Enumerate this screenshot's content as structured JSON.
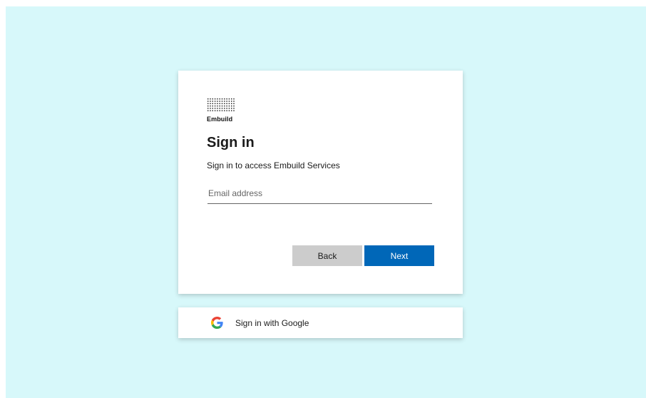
{
  "brand": {
    "name": "Embuild"
  },
  "signin": {
    "title": "Sign in",
    "subtitle": "Sign in to access Embuild Services",
    "email_placeholder": "Email address",
    "email_value": "",
    "back_label": "Back",
    "next_label": "Next"
  },
  "google": {
    "label": "Sign in with Google",
    "icon": "google-g-icon"
  },
  "colors": {
    "background": "#d7f8fa",
    "primary": "#0067b8",
    "secondary_button": "#cccccc",
    "google_blue": "#4285F4",
    "google_red": "#EA4335",
    "google_yellow": "#FBBC05",
    "google_green": "#34A853"
  }
}
